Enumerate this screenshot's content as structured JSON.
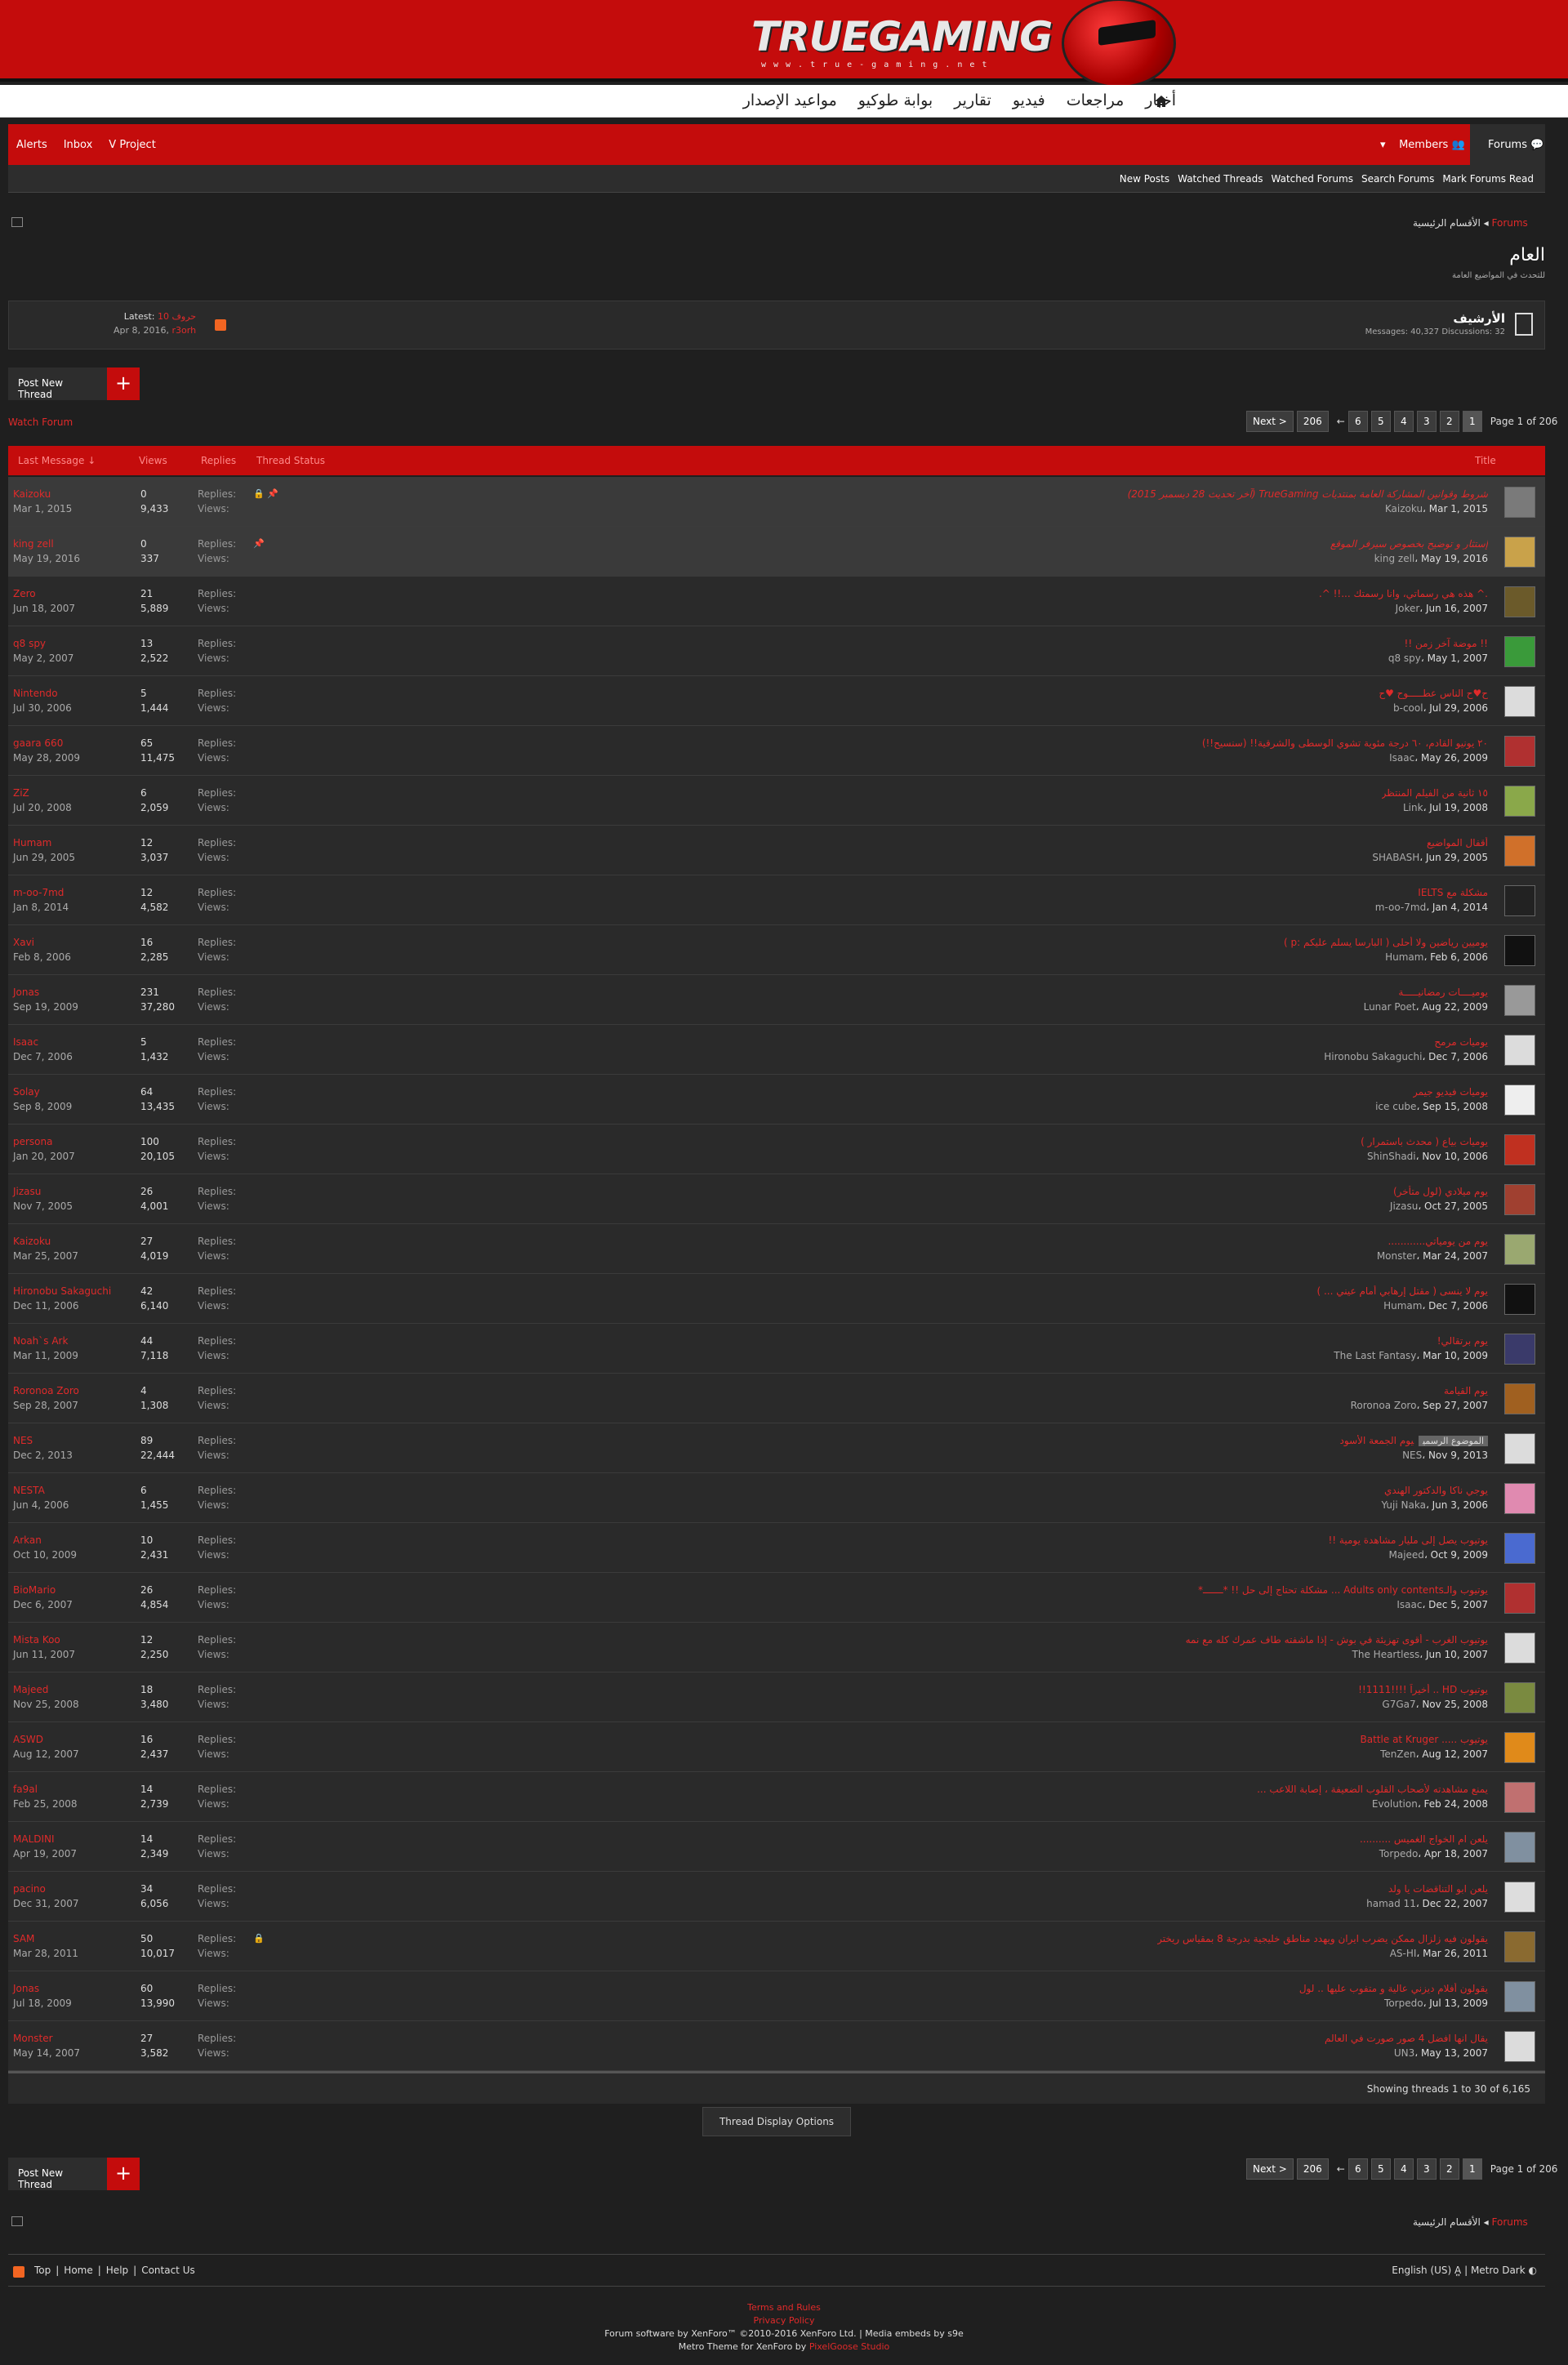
{
  "header": {
    "logo_text": "TRUEGAMING",
    "logo_sub": "www.true-gaming.net"
  },
  "topnav": [
    "أخبار",
    "مراجعات",
    "فيديو",
    "تقارير",
    "بوابة طوكيو",
    "مواعيد الإصدار"
  ],
  "userbar": {
    "alerts": "Alerts",
    "inbox": "Inbox",
    "user": "V Project",
    "members": "Members",
    "forums": "Forums"
  },
  "subnav": [
    "New Posts",
    "Watched Threads",
    "Watched Forums",
    "Search Forums",
    "Mark Forums Read"
  ],
  "breadcrumb": {
    "root": "Forums",
    "section": "الأقسام الرئيسية"
  },
  "page": {
    "title": "العام",
    "subtitle": "للتحدث في المواضيع العامة"
  },
  "archive": {
    "name": "الأرشيف",
    "stats": "Messages: 40,327 Discussions: 32",
    "latest_label": "Latest:",
    "latest_title": "10 حروف",
    "latest_user": "r3orh",
    "latest_date": "Apr 8, 2016"
  },
  "actions": {
    "post_new_thread": "Post New Thread",
    "watch_forum": "Watch Forum",
    "thread_display_options": "Thread Display Options",
    "showing": "Showing threads 1 to 30 of 6,165"
  },
  "pager": {
    "next": "Next >",
    "last": "206",
    "pages": [
      "6",
      "5",
      "4",
      "3",
      "2",
      "1"
    ],
    "info": "Page 1 of 206",
    "ellipsis": "←"
  },
  "columns": {
    "title": "Title",
    "last_message": "Last Message ↓",
    "replies": "Replies",
    "views": "Views",
    "thread_status": "Thread Status"
  },
  "labels": {
    "replies": "Replies:",
    "views": "Views:"
  },
  "threads": [
    {
      "title": "شروط وقوانين المشاركة العامة بمنتديات TrueGaming (آخر تحديث 28 ديسمبر 2015)",
      "author": "Kaizoku",
      "date": "Mar 1, 2015",
      "replies": "0",
      "views": "9,433",
      "last_user": "Kaizoku",
      "last_date": "Mar 1, 2015",
      "sticky": true,
      "locked": true,
      "av": "#7a7a7a"
    },
    {
      "title": "إستثار و توضيح بخصوص سيرفر الموقع",
      "author": "king zell",
      "date": "May 19, 2016",
      "replies": "0",
      "views": "337",
      "last_user": "king zell",
      "last_date": "May 19, 2016",
      "sticky": true,
      "locked": false,
      "av": "#c9a24a"
    },
    {
      "title": ".^ هذه هي رسماتي، وانا رسمتك ...!! ^.",
      "author": "Joker",
      "date": "Jun 16, 2007",
      "replies": "21",
      "views": "5,889",
      "last_user": "Zero",
      "last_date": "Jun 18, 2007",
      "av": "#6b5a2a"
    },
    {
      "title": "!! موضة آخر زمن !!",
      "author": "q8 spy",
      "date": "May 1, 2007",
      "replies": "13",
      "views": "2,522",
      "last_user": "q8 spy",
      "last_date": "May 2, 2007",
      "av": "#3a9a3a"
    },
    {
      "title": "ح♥ح الناس عطـــــوح ♥ح",
      "author": "b-cool",
      "date": "Jul 29, 2006",
      "replies": "5",
      "views": "1,444",
      "last_user": "Nintendo",
      "last_date": "Jul 30, 2006",
      "av": "#dcdcdc"
    },
    {
      "title": "٢٠ يونيو القادم، ٦٠ درجة مئوية تشوي الوسطى والشرقية!! (سنسيح!!)",
      "author": "Isaac",
      "date": "May 26, 2009",
      "replies": "65",
      "views": "11,475",
      "last_user": "gaara 660",
      "last_date": "May 28, 2009",
      "av": "#b03030"
    },
    {
      "title": "١٥ ثانية من الفيلم المنتظر",
      "author": "Link",
      "date": "Jul 19, 2008",
      "replies": "6",
      "views": "2,059",
      "last_user": "ZiZ",
      "last_date": "Jul 20, 2008",
      "av": "#8aa84a"
    },
    {
      "title": "أقفال المواضيع",
      "author": "SHABASH",
      "date": "Jun 29, 2005",
      "replies": "12",
      "views": "3,037",
      "last_user": "Humam",
      "last_date": "Jun 29, 2005",
      "av": "#d0702a"
    },
    {
      "title": "مشكلة مع IELTS",
      "author": "m-oo-7md",
      "date": "Jan 4, 2014",
      "replies": "12",
      "views": "4,582",
      "last_user": "m-oo-7md",
      "last_date": "Jan 8, 2014",
      "av": "#222"
    },
    {
      "title": "يوميين رياضين ولا أحلى ( البارسا يسلم عليكم :p )",
      "author": "Humam",
      "date": "Feb 6, 2006",
      "replies": "16",
      "views": "2,285",
      "last_user": "Xavi",
      "last_date": "Feb 8, 2006",
      "av": "#111"
    },
    {
      "title": "يوميــــات رمضانيـــــة",
      "author": "Lunar Poet",
      "date": "Aug 22, 2009",
      "replies": "231",
      "views": "37,280",
      "last_user": "Jonas",
      "last_date": "Sep 19, 2009",
      "av": "#999"
    },
    {
      "title": "يوميات مرمح",
      "author": "Hironobu Sakaguchi",
      "date": "Dec 7, 2006",
      "replies": "5",
      "views": "1,432",
      "last_user": "Isaac",
      "last_date": "Dec 7, 2006",
      "av": "#dcdcdc"
    },
    {
      "title": "يوميات فيديو جيمر",
      "author": "ice cube",
      "date": "Sep 15, 2008",
      "replies": "64",
      "views": "13,435",
      "last_user": "Solay",
      "last_date": "Sep 8, 2009",
      "av": "#eee"
    },
    {
      "title": "يوميات بياع ( محدث باستمرار )",
      "author": "ShinShadi",
      "date": "Nov 10, 2006",
      "replies": "100",
      "views": "20,105",
      "last_user": "persona",
      "last_date": "Jan 20, 2007",
      "av": "#c03020"
    },
    {
      "title": "يوم ميلادي (لول متأخر)",
      "author": "Jizasu",
      "date": "Oct 27, 2005",
      "replies": "26",
      "views": "4,001",
      "last_user": "Jizasu",
      "last_date": "Nov 7, 2005",
      "av": "#a04030"
    },
    {
      "title": "يوم من يومياتي............",
      "author": "Monster",
      "date": "Mar 24, 2007",
      "replies": "27",
      "views": "4,019",
      "last_user": "Kaizoku",
      "last_date": "Mar 25, 2007",
      "av": "#9aa870"
    },
    {
      "title": "يوم لا ينسى ( مقتل إرهابي أمام عيني ... )",
      "author": "Humam",
      "date": "Dec 7, 2006",
      "replies": "42",
      "views": "6,140",
      "last_user": "Hironobu Sakaguchi",
      "last_date": "Dec 11, 2006",
      "av": "#111"
    },
    {
      "title": "يوم برتقالي!",
      "author": "The Last Fantasy",
      "date": "Mar 10, 2009",
      "replies": "44",
      "views": "7,118",
      "last_user": "Noah`s Ark",
      "last_date": "Mar 11, 2009",
      "av": "#3a3a6a"
    },
    {
      "title": "يوم القيامة",
      "author": "Roronoa Zoro",
      "date": "Sep 27, 2007",
      "replies": "4",
      "views": "1,308",
      "last_user": "Roronoa Zoro",
      "last_date": "Sep 28, 2007",
      "av": "#a06020"
    },
    {
      "title": "يوم الجمعة الأسود",
      "prefix": "الموضوع الرسمي",
      "author": "NES",
      "date": "Nov 9, 2013",
      "replies": "89",
      "views": "22,444",
      "last_user": "NES",
      "last_date": "Dec 2, 2013",
      "av": "#dcdcdc"
    },
    {
      "title": "يوجي ناكا والدكتور الهندي",
      "author": "Yuji Naka",
      "date": "Jun 3, 2006",
      "replies": "6",
      "views": "1,455",
      "last_user": "NESTA",
      "last_date": "Jun 4, 2006",
      "av": "#e08ab0"
    },
    {
      "title": "يوتيوب يصل إلى مليار مشاهدة يومية !!",
      "author": "Majeed",
      "date": "Oct 9, 2009",
      "replies": "10",
      "views": "2,431",
      "last_user": "Arkan",
      "last_date": "Oct 10, 2009",
      "av": "#4a6ad0"
    },
    {
      "title": "يوتيوب والـAdults only contents ... مشكلة تحتاج إلى حل !! *ـــــــ*",
      "author": "Isaac",
      "date": "Dec 5, 2007",
      "replies": "26",
      "views": "4,854",
      "last_user": "BioMario",
      "last_date": "Dec 6, 2007",
      "av": "#b03030"
    },
    {
      "title": "يوتيوب الغرب - أقوى تهزيئة في بوش - إذا ماشفته طاف عمرك كله مع نمه",
      "author": "The Heartless",
      "date": "Jun 10, 2007",
      "replies": "12",
      "views": "2,250",
      "last_user": "Mista Koo",
      "last_date": "Jun 11, 2007",
      "av": "#dcdcdc"
    },
    {
      "title": "يوتيوب HD .. أخيراً !!!!1111!!",
      "author": "G7Ga7",
      "date": "Nov 25, 2008",
      "replies": "18",
      "views": "3,480",
      "last_user": "Majeed",
      "last_date": "Nov 25, 2008",
      "av": "#7a8a40"
    },
    {
      "title": "يوتيوب ..... Battle at Kruger",
      "author": "TenZen",
      "date": "Aug 12, 2007",
      "replies": "16",
      "views": "2,437",
      "last_user": "ASWD",
      "last_date": "Aug 12, 2007",
      "av": "#e08a1a"
    },
    {
      "title": "يمنع مشاهدته لأصحاب القلوب الضعيفة ، إصابة اللاعب ...",
      "author": "Evolution",
      "date": "Feb 24, 2008",
      "replies": "14",
      "views": "2,739",
      "last_user": "fa9al",
      "last_date": "Feb 25, 2008",
      "av": "#c07070"
    },
    {
      "title": "يلعن ام الخواج الغميس ..........",
      "author": "Torpedo",
      "date": "Apr 18, 2007",
      "replies": "14",
      "views": "2,349",
      "last_user": "MALDINI",
      "last_date": "Apr 19, 2007",
      "av": "#8090a0"
    },
    {
      "title": "يلعن ابو التناقضات يا ولد",
      "author": "hamad 11",
      "date": "Dec 22, 2007",
      "replies": "34",
      "views": "6,056",
      "last_user": "pacino",
      "last_date": "Dec 31, 2007",
      "av": "#ddd"
    },
    {
      "title": "يقولون فيه زلزال ممكن يضرب ايران ويهدد مناطق خليجية بدرجة 8 بمقياس ريختر",
      "author": "AS-HI",
      "date": "Mar 26, 2011",
      "replies": "50",
      "views": "10,017",
      "last_user": "SAM",
      "last_date": "Mar 28, 2011",
      "locked": true,
      "av": "#8a6a30"
    },
    {
      "title": "يقولون أفلام ديزني عالية و متفوب عليها .. لول",
      "author": "Torpedo",
      "date": "Jul 13, 2009",
      "replies": "60",
      "views": "13,990",
      "last_user": "Jonas",
      "last_date": "Jul 18, 2009",
      "av": "#8090a0"
    },
    {
      "title": "يقال انها افضل 4 صور صورت في العالم",
      "author": "UN3",
      "date": "May 13, 2007",
      "replies": "27",
      "views": "3,582",
      "last_user": "Monster",
      "last_date": "May 14, 2007",
      "av": "#dcdcdc"
    }
  ],
  "footer": {
    "links": [
      "Top",
      "Home",
      "Help",
      "Contact Us"
    ],
    "lang": "English (US)",
    "style": "Metro Dark",
    "terms": "Terms and Rules",
    "privacy": "Privacy Policy",
    "copy1": "Forum software by XenForo™ ©2010-2016 XenForo Ltd. | Media embeds by s9e",
    "copy2": "Metro Theme for XenForo by",
    "copy2_link": "PixelGoose Studio"
  }
}
